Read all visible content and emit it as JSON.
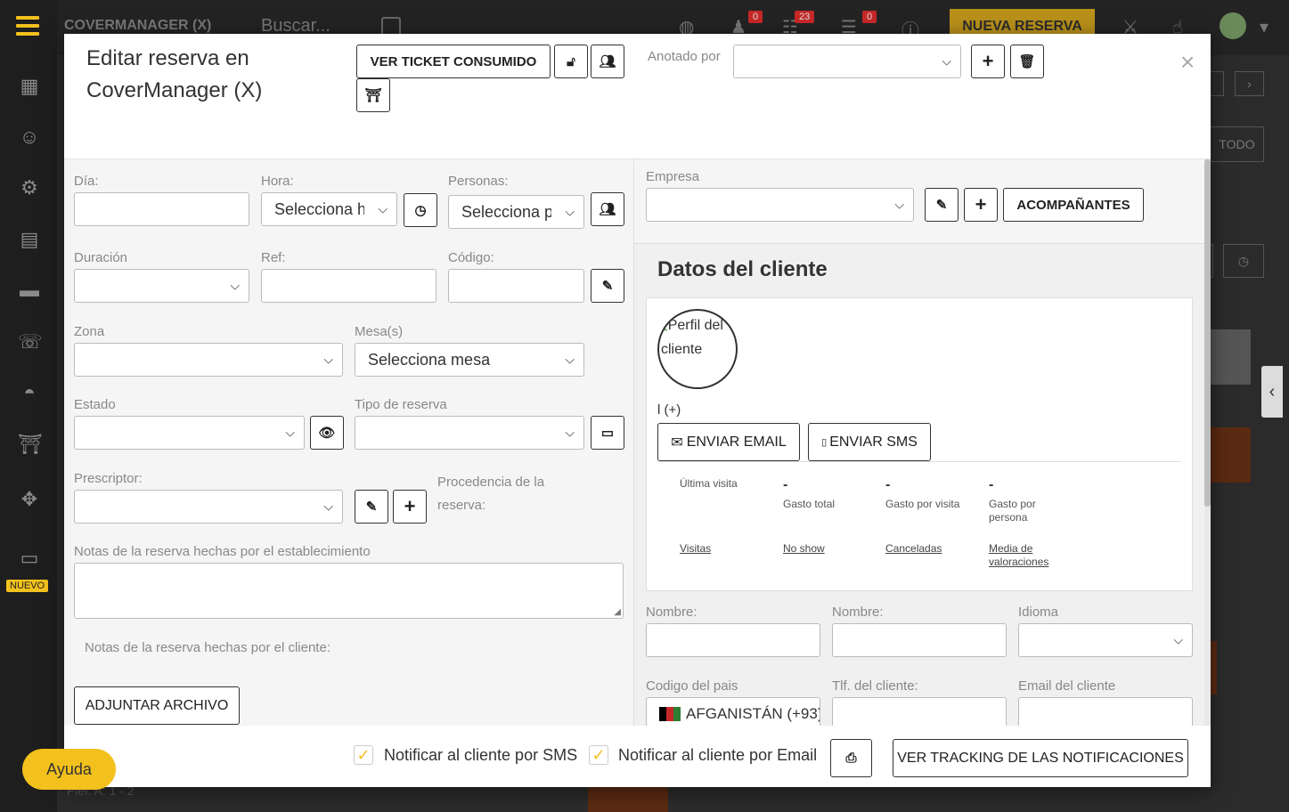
{
  "background": {
    "brand": "COVERMANAGER (X)",
    "search_placeholder": "Buscar...",
    "new_booking_button": "NUEVA RESERVA",
    "badges": [
      "0",
      "23",
      "0"
    ],
    "nuevo_tag": "NUEVO",
    "todo_button": "TODO",
    "partial_text": "Piel. A: 1 - 2"
  },
  "modal": {
    "title": "Editar reserva en CoverManager (X)",
    "header": {
      "ticket_button": "VER TICKET CONSUMIDO",
      "annotated_by_label": "Anotado por",
      "annotated_by_value": ""
    },
    "left": {
      "dia_label": "Día:",
      "dia_value": "",
      "hora_label": "Hora:",
      "hora_value": "Selecciona hora",
      "personas_label": "Personas:",
      "personas_value": "Selecciona pax",
      "duracion_label": "Duración",
      "duracion_value": "",
      "ref_label": "Ref:",
      "ref_value": "",
      "codigo_label": "Código:",
      "codigo_value": "",
      "zona_label": "Zona",
      "zona_value": "",
      "mesas_label": "Mesa(s)",
      "mesas_value": "Selecciona mesa",
      "estado_label": "Estado",
      "estado_value": "",
      "tipo_label": "Tipo de reserva",
      "tipo_value": "",
      "prescriptor_label": "Prescriptor:",
      "prescriptor_value": "",
      "procedencia_label": "Procedencia de la reserva:",
      "notas_est_label": "Notas de la reserva hechas por el establecimiento",
      "notas_cliente_label": "Notas de la reserva hechas por el cliente:",
      "attach_button": "ADJUNTAR ARCHIVO"
    },
    "right": {
      "empresa_label": "Empresa",
      "empresa_value": "",
      "companions_button": "ACOMPAÑANTES",
      "section_title": "Datos del cliente",
      "avatar_alt": "Perfil del cliente",
      "client_name": "l (+)",
      "email_button": "ENVIAR EMAIL",
      "sms_button": "ENVIAR SMS",
      "stats": {
        "ultima_visita_label": "Última visita",
        "gasto_total_value": "-",
        "gasto_total_label": "Gasto total",
        "gasto_visita_value": "-",
        "gasto_visita_label": "Gasto por visita",
        "gasto_persona_value": "-",
        "gasto_persona_label": "Gasto por persona",
        "visitas_link": "Visitas",
        "noshow_link": "No show",
        "canceladas_link": "Canceladas",
        "valoraciones_link": "Media de valoraciones"
      },
      "nombre1_label": "Nombre:",
      "nombre2_label": "Nombre:",
      "idioma_label": "Idioma",
      "codigo_pais_label": "Codigo del pais",
      "codigo_pais_value": "AFGANISTÁN (+93)",
      "tlf_label": "Tlf. del cliente:",
      "email_label": "Email del cliente"
    },
    "footer": {
      "sms_notify": "Notificar al cliente por SMS",
      "email_notify": "Notificar al cliente por Email",
      "tracking_button": "VER TRACKING DE LAS NOTIFICACIONES"
    }
  },
  "help_button": "Ayuda",
  "colors": {
    "accent": "#f2c11d",
    "dark": "#232323"
  }
}
